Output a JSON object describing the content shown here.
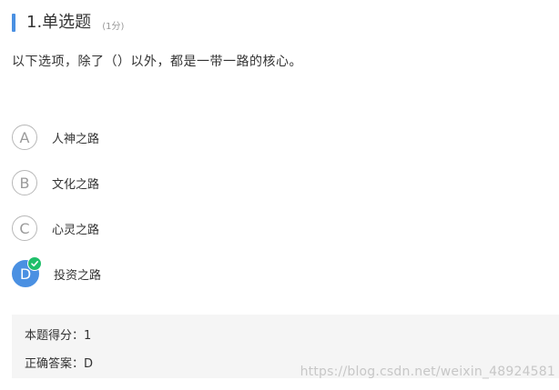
{
  "question": {
    "title": "1.单选题",
    "score": "(1分)",
    "text": "以下选项，除了（）以外，都是一带一路的核心。"
  },
  "options": [
    {
      "letter": "A",
      "label": "人神之路",
      "selected": false
    },
    {
      "letter": "B",
      "label": "文化之路",
      "selected": false
    },
    {
      "letter": "C",
      "label": "心灵之路",
      "selected": false
    },
    {
      "letter": "D",
      "label": "投资之路",
      "selected": true
    }
  ],
  "result": {
    "score_line": "本题得分：1",
    "answer_line": "正确答案：D"
  },
  "watermark": "https://blog.csdn.net/weixin_48924581",
  "colors": {
    "accent": "#4a90e2",
    "check": "#1fbf6a",
    "answer_bg": "#f5f5f5"
  },
  "icons": {
    "selected_badge": "checkmark-icon"
  }
}
